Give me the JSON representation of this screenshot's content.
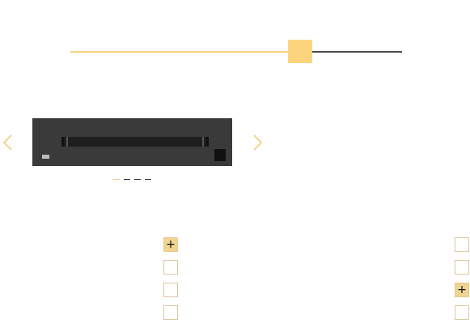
{
  "colors": {
    "accent": "#fcd47e",
    "track_active": "#f6d37e",
    "track_inactive": "#4a4a4a",
    "dot_active": "#f6c97a",
    "dot_inactive": "#333333",
    "toggle_active_bg": "#f0d592"
  },
  "slider": {
    "value_fraction": 0.75
  },
  "carousel": {
    "prev_icon": "chevron-left-icon",
    "next_icon": "chevron-right-icon",
    "slide_count": 4,
    "active_index": 0
  },
  "accordion": {
    "left_column": [
      {
        "icon": "plus-icon",
        "glyph": "+",
        "active": true
      },
      {
        "icon": "box-icon",
        "glyph": "",
        "active": false
      },
      {
        "icon": "box-icon",
        "glyph": "",
        "active": false
      },
      {
        "icon": "box-icon",
        "glyph": "",
        "active": false
      }
    ],
    "right_column": [
      {
        "icon": "box-icon",
        "glyph": "",
        "active": false
      },
      {
        "icon": "box-icon",
        "glyph": "",
        "active": false
      },
      {
        "icon": "plus-icon",
        "glyph": "+",
        "active": true
      },
      {
        "icon": "box-icon",
        "glyph": "",
        "active": false
      }
    ]
  }
}
